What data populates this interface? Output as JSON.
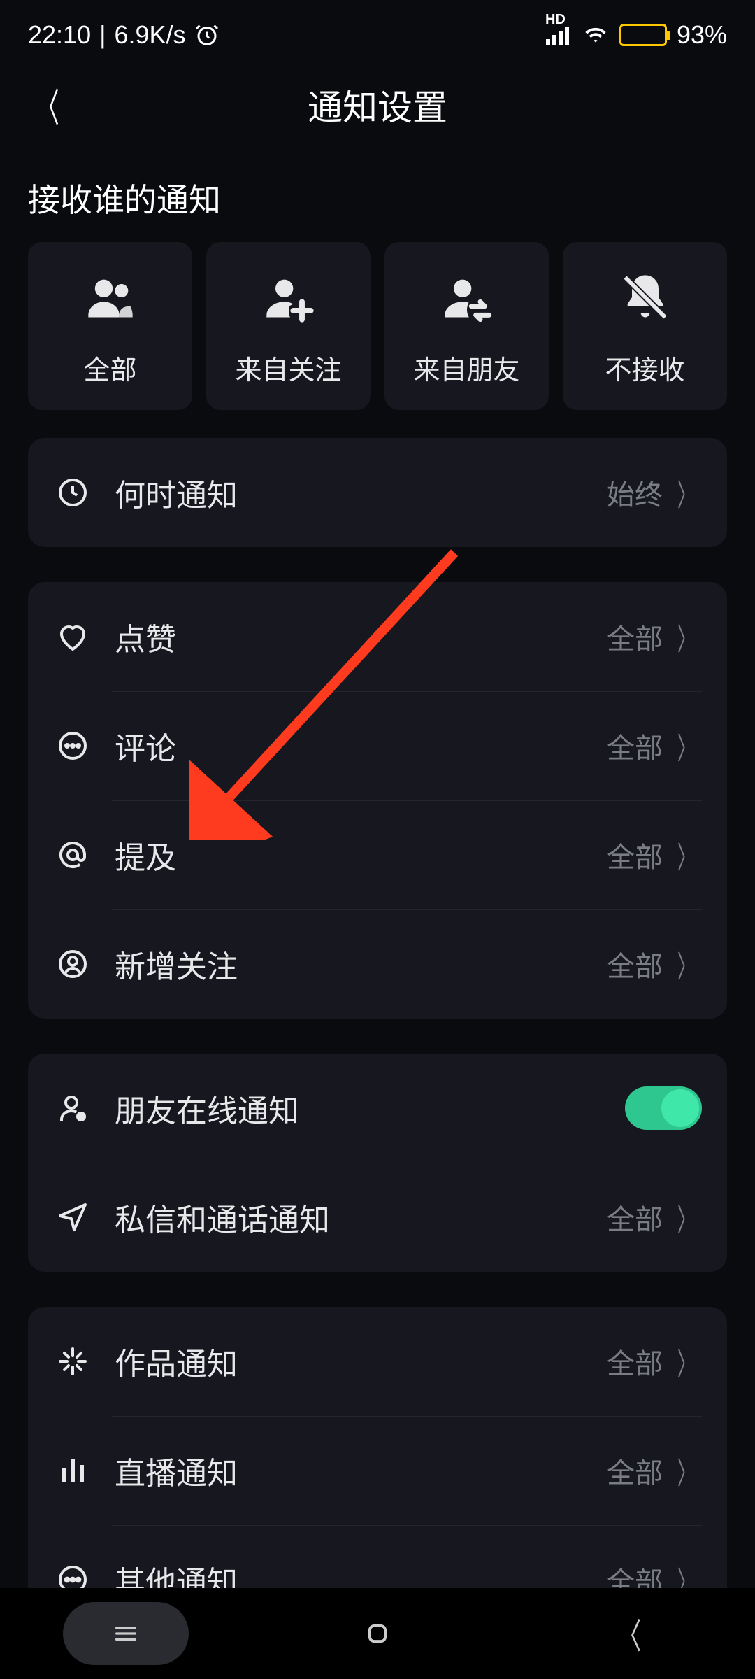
{
  "status": {
    "time": "22:10",
    "speed": "6.9K/s",
    "battery_pct": "93%"
  },
  "header": {
    "title": "通知设置"
  },
  "source_section": {
    "heading": "接收谁的通知",
    "options": [
      {
        "label": "全部",
        "icon": "users"
      },
      {
        "label": "来自关注",
        "icon": "user-plus"
      },
      {
        "label": "来自朋友",
        "icon": "user-swap"
      },
      {
        "label": "不接收",
        "icon": "bell-off"
      }
    ]
  },
  "groups": [
    {
      "rows": [
        {
          "icon": "clock",
          "label": "何时通知",
          "value": "始终",
          "type": "nav"
        }
      ]
    },
    {
      "rows": [
        {
          "icon": "heart",
          "label": "点赞",
          "value": "全部",
          "type": "nav"
        },
        {
          "icon": "comment",
          "label": "评论",
          "value": "全部",
          "type": "nav"
        },
        {
          "icon": "at",
          "label": "提及",
          "value": "全部",
          "type": "nav"
        },
        {
          "icon": "person-circle",
          "label": "新增关注",
          "value": "全部",
          "type": "nav"
        }
      ]
    },
    {
      "rows": [
        {
          "icon": "user-dot",
          "label": "朋友在线通知",
          "value": null,
          "type": "toggle",
          "on": true
        },
        {
          "icon": "send",
          "label": "私信和通话通知",
          "value": "全部",
          "type": "nav"
        }
      ]
    },
    {
      "rows": [
        {
          "icon": "sparkle",
          "label": "作品通知",
          "value": "全部",
          "type": "nav"
        },
        {
          "icon": "bars",
          "label": "直播通知",
          "value": "全部",
          "type": "nav"
        },
        {
          "icon": "dots-circle",
          "label": "其他通知",
          "value": "全部",
          "type": "nav"
        }
      ]
    }
  ]
}
